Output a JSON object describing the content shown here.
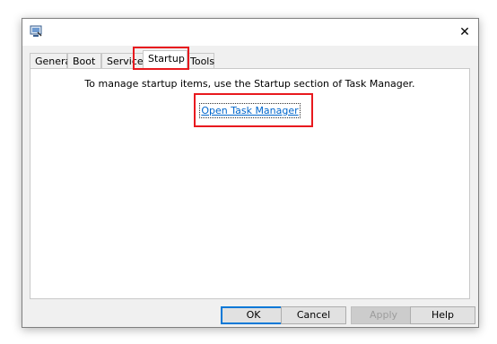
{
  "window": {
    "title": "",
    "close_glyph": "✕"
  },
  "tabs": [
    {
      "label": "General",
      "active": false
    },
    {
      "label": "Boot",
      "active": false
    },
    {
      "label": "Services",
      "active": false
    },
    {
      "label": "Startup",
      "active": true
    },
    {
      "label": "Tools",
      "active": false
    }
  ],
  "startup": {
    "info_text": "To manage startup items, use the Startup section of Task Manager.",
    "link_label": "Open Task Manager"
  },
  "buttons": {
    "ok": "OK",
    "cancel": "Cancel",
    "apply": "Apply",
    "help": "Help"
  },
  "colors": {
    "highlight": "#e8191e",
    "link": "#0066cc",
    "default_button_border": "#0078d7"
  },
  "icons": {
    "app": "system-config-icon",
    "close": "close-icon"
  }
}
